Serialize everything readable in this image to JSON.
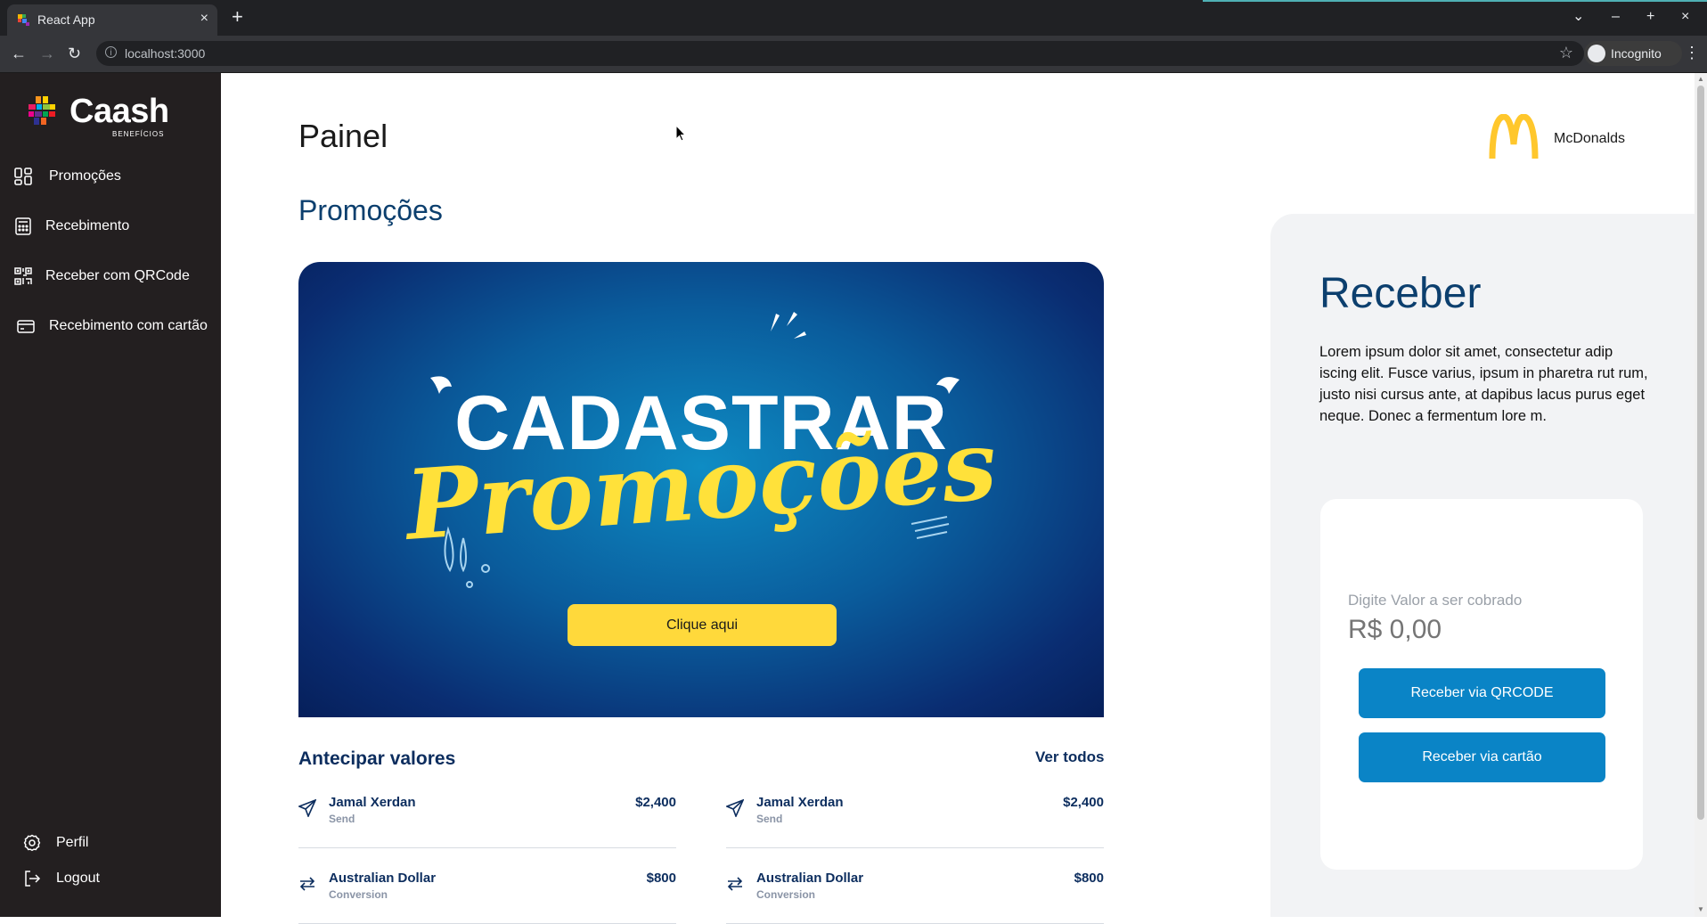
{
  "browser": {
    "tab_title": "React App",
    "tab_close": "×",
    "new_tab": "+",
    "url": "localhost:3000",
    "incognito_label": "Incognito",
    "window_controls": [
      "⌄",
      "–",
      "+",
      "×"
    ]
  },
  "sidebar": {
    "logo_text": "Caash",
    "logo_sub": "BENEFÍCIOS",
    "items": [
      {
        "label": "Promoções",
        "icon": "grid-icon"
      },
      {
        "label": "Recebimento",
        "icon": "calculator-icon"
      },
      {
        "label": "Receber com QRCode",
        "icon": "qrcode-icon"
      },
      {
        "label": "Recebimento com cartão",
        "icon": "credit-card-icon"
      }
    ],
    "bottom_items": [
      {
        "label": "Perfil",
        "icon": "gear-icon"
      },
      {
        "label": "Logout",
        "icon": "logout-icon"
      }
    ]
  },
  "header": {
    "title": "Painel",
    "brand_name": "McDonalds",
    "brand_color": "#ffc72c"
  },
  "promotions": {
    "title": "Promoções",
    "banner_line1": "CADASTRAR",
    "banner_line2": "Promoções",
    "button_label": "Clique aqui"
  },
  "antecipar": {
    "title": "Antecipar valores",
    "view_all": "Ver todos",
    "transactions": [
      {
        "name": "Jamal Xerdan",
        "type": "Send",
        "amount": "$2,400",
        "icon": "send-icon"
      },
      {
        "name": "Jamal Xerdan",
        "type": "Send",
        "amount": "$2,400",
        "icon": "send-icon"
      },
      {
        "name": "Australian Dollar",
        "type": "Conversion",
        "amount": "$800",
        "icon": "exchange-icon"
      },
      {
        "name": "Australian Dollar",
        "type": "Conversion",
        "amount": "$800",
        "icon": "exchange-icon"
      }
    ]
  },
  "receber": {
    "title": "Receber",
    "description": "Lorem ipsum dolor sit amet, consectetur adip iscing elit. Fusce varius, ipsum in pharetra rut rum, justo nisi cursus ante, at dapibus lacus purus eget neque. Donec a fermentum lore m.",
    "value_label": "Digite Valor a ser cobrado",
    "value_placeholder": "R$ 0,00",
    "qrcode_button": "Receber via QRCODE",
    "card_button": "Receber via cartão"
  },
  "colors": {
    "sidebar_bg": "#231f20",
    "primary_blue": "#0a84c6",
    "heading_blue": "#0c3f6e",
    "promo_yellow": "#ffd93b"
  }
}
